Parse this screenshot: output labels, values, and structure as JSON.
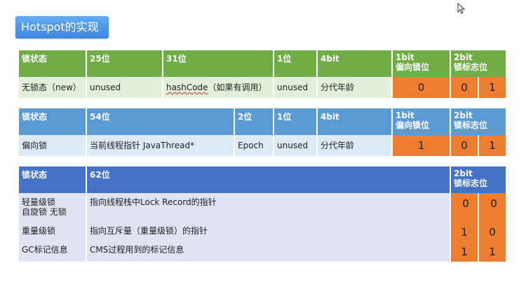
{
  "title": "Hotspot的实现",
  "table1": {
    "headers": [
      "锁状态",
      "25位",
      "31位",
      "1位",
      "4bit",
      "1bit\n偏向锁位",
      "2bit\n锁标志位"
    ],
    "row": [
      "无锁态（new）",
      "unused",
      "hashCode",
      "（如果有调用）",
      "unused",
      "分代年龄",
      "0",
      "0",
      "1"
    ]
  },
  "table2": {
    "headers": [
      "锁状态",
      "54位",
      "2位",
      "1位",
      "4bit",
      "1bit\n偏向锁位",
      "2bit\n锁标志位"
    ],
    "row": [
      "偏向锁",
      "当前线程指针 JavaThread*",
      "Epoch",
      "unused",
      "分代年龄",
      "1",
      "0",
      "1"
    ]
  },
  "table3": {
    "headers": [
      "锁状态",
      "62位",
      "2bit\n锁标志位"
    ],
    "rows": [
      {
        "state": "轻量级锁\n自旋锁 无锁",
        "desc": "指向线程栈中Lock Record的指针",
        "bits": [
          "0",
          "0"
        ]
      },
      {
        "state": "重量级锁",
        "desc": "指向互斥量（重量级锁）的指针",
        "bits": [
          "1",
          "0"
        ]
      },
      {
        "state": "GC标记信息",
        "desc": "CMS过程用到的标记信息",
        "bits": [
          "1",
          "1"
        ]
      }
    ]
  }
}
